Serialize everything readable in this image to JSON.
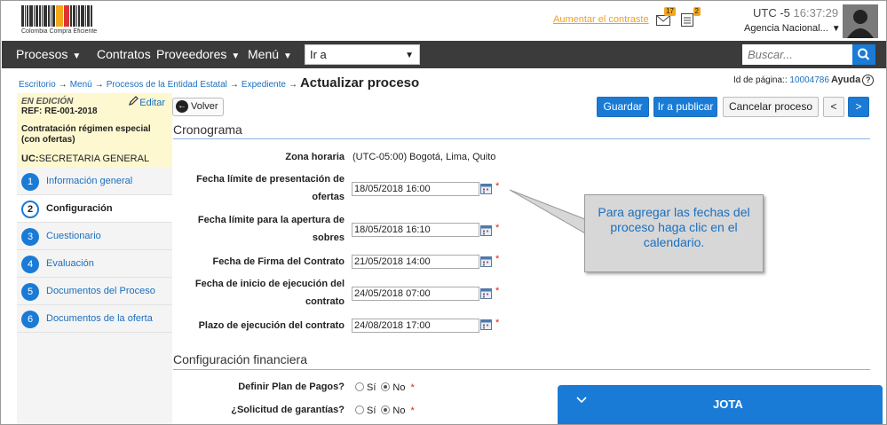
{
  "header": {
    "logo_text": "Colombia Compra Eficiente",
    "contrast_link": "Aumentar el contraste",
    "mail_badge": "17",
    "tasks_badge": "2",
    "timezone": "UTC -5",
    "time": "16:37:29",
    "agency": "Agencia Nacional..."
  },
  "nav": {
    "items": [
      "Procesos",
      "Contratos",
      "Proveedores",
      "Menú"
    ],
    "goto_label": "Ir a",
    "search_placeholder": "Buscar..."
  },
  "breadcrumb": {
    "items": [
      "Escritorio",
      "Menú",
      "Procesos de la Entidad Estatal",
      "Expediente"
    ],
    "current": "Actualizar proceso"
  },
  "page_id": {
    "label": "Id de página::",
    "value": "10004786"
  },
  "help_label": "Ayuda",
  "status": {
    "edit_state": "EN EDICIÓN",
    "edit_link": "Editar",
    "ref": "REF: RE-001-2018",
    "process_type": "Contratación régimen especial (con ofertas)",
    "uc_label": "UC:",
    "uc_value": "SECRETARIA GENERAL"
  },
  "steps": [
    {
      "num": "1",
      "label": "Información general"
    },
    {
      "num": "2",
      "label": "Configuración"
    },
    {
      "num": "3",
      "label": "Cuestionario"
    },
    {
      "num": "4",
      "label": "Evaluación"
    },
    {
      "num": "5",
      "label": "Documentos del Proceso"
    },
    {
      "num": "6",
      "label": "Documentos de la oferta"
    }
  ],
  "active_step": 2,
  "toolbar": {
    "back": "Volver",
    "save": "Guardar",
    "publish": "Ir a publicar",
    "cancel": "Cancelar proceso",
    "prev": "<",
    "next": ">"
  },
  "cronograma": {
    "title": "Cronograma",
    "timezone_label": "Zona horaria",
    "timezone_value": "(UTC-05:00) Bogotá, Lima, Quito",
    "fields": [
      {
        "label": "Fecha límite de presentación de ofertas",
        "value": "18/05/2018 16:00"
      },
      {
        "label": "Fecha límite para la apertura de sobres",
        "value": "18/05/2018 16:10"
      },
      {
        "label": "Fecha de Firma del Contrato",
        "value": "21/05/2018 14:00"
      },
      {
        "label": "Fecha de inicio de ejecución del contrato",
        "value": "24/05/2018 07:00"
      },
      {
        "label": "Plazo de ejecución del contrato",
        "value": "24/08/2018 17:00"
      }
    ]
  },
  "financiera": {
    "title": "Configuración financiera",
    "fields": [
      {
        "label": "Definir Plan de Pagos?",
        "yes": "Sí",
        "no": "No",
        "selected": "No"
      },
      {
        "label": "¿Solicitud de garantías?",
        "yes": "Sí",
        "no": "No",
        "selected": "No"
      }
    ]
  },
  "callout": "Para agregar las fechas del proceso haga clic en el calendario.",
  "jota": {
    "title": "JOTA"
  },
  "colors": {
    "accent": "#1a7bd6",
    "nav_bg": "#3b3b3b",
    "status_bg": "#fdf8d0",
    "link": "#1a6fbf",
    "required": "#dd2222"
  }
}
